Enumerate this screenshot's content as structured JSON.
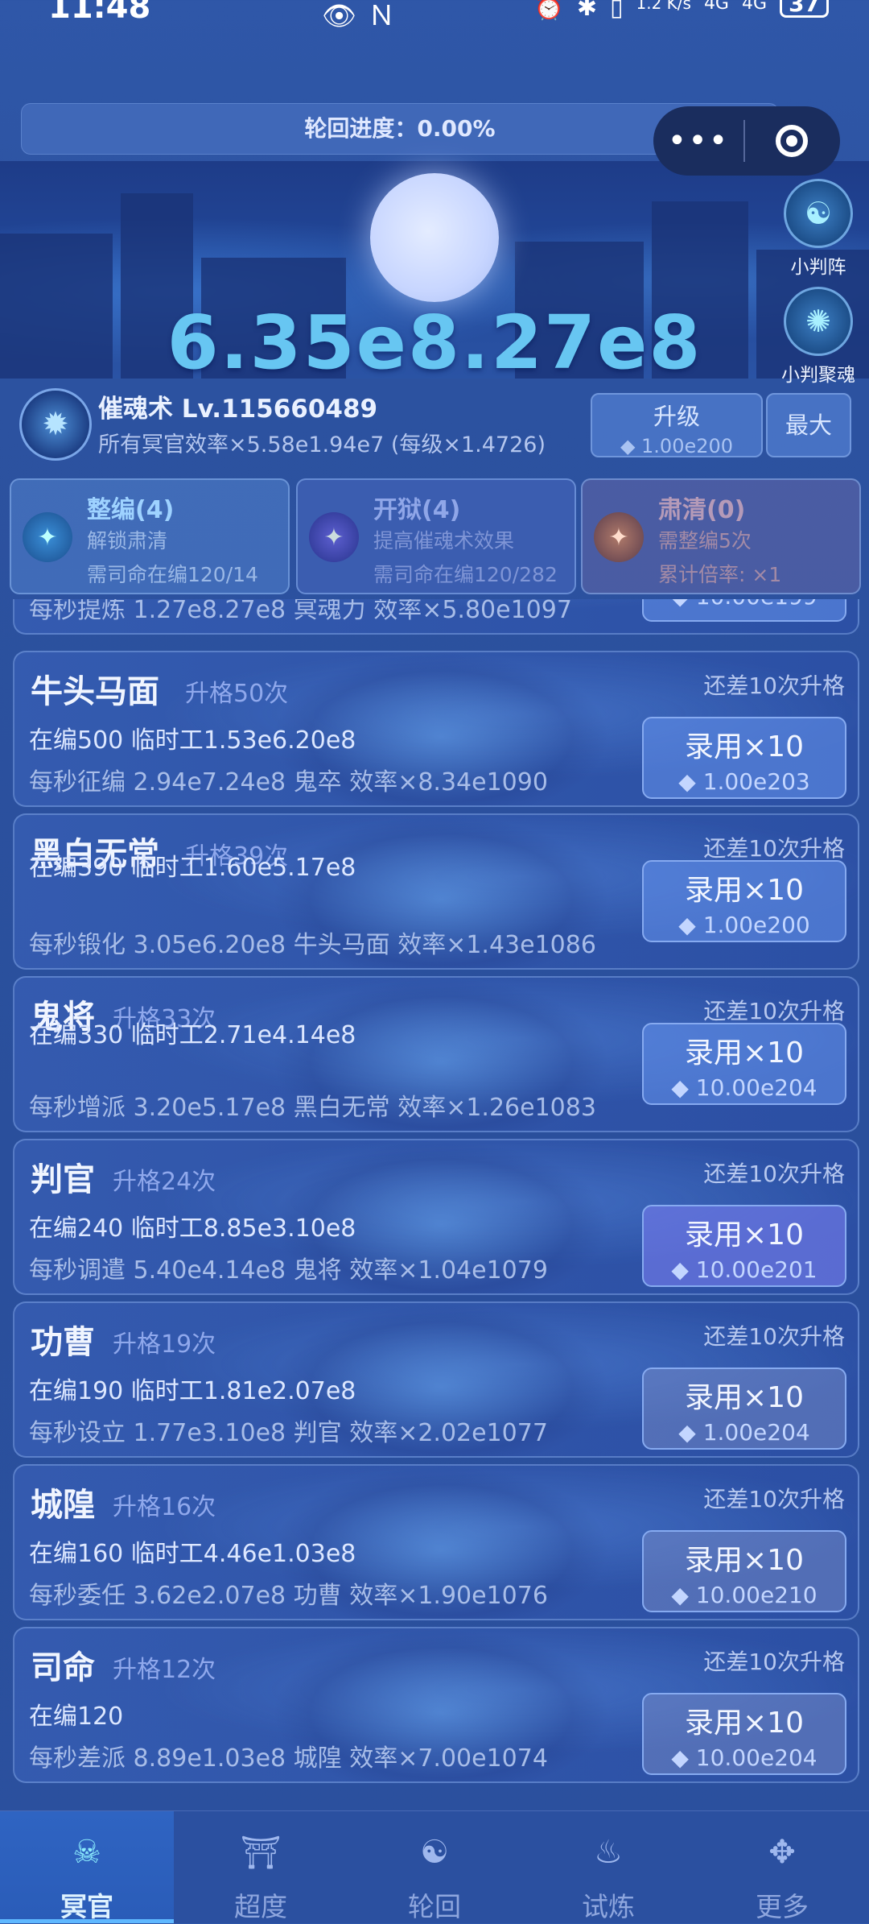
{
  "status_bar": {
    "time": "11:48",
    "icons": [
      "eye-icon",
      "nfc-icon"
    ],
    "right_icons": [
      "alarm-icon",
      "bluetooth-icon",
      "vibrate-icon"
    ],
    "net_speed": "1.2 K/s",
    "signal1": "4G",
    "signal2": "4G",
    "battery": "37"
  },
  "progress": {
    "label": "轮回进度：0.00%",
    "fraction": 0.0
  },
  "hero": {
    "big_number": "6.35e8.27e8"
  },
  "side_buttons": [
    {
      "label": "小判阵",
      "icon": "formation-icon"
    },
    {
      "label": "小判聚魂",
      "icon": "soul-gather-icon"
    }
  ],
  "skill": {
    "title": "催魂术 Lv.115660489",
    "desc": "所有冥官效率×5.58e1.94e7 (每级×1.4726)",
    "upgrade_label": "升级",
    "upgrade_cost": "◆ 1.00e200",
    "max_label": "最大"
  },
  "top_cards": [
    {
      "title": "整编(4)",
      "line1": "解锁肃清",
      "line2": "需司命在编120/14"
    },
    {
      "title": "开狱(4)",
      "line1": "提高催魂术效果",
      "line2": "需司命在编120/282"
    },
    {
      "title": "肃清(0)",
      "line1": "需整编5次",
      "line2": "累计倍率: ×1"
    }
  ],
  "partial_card": {
    "line3": "每秒提炼 1.27e8.27e8 冥魂力  效率×5.80e1097",
    "cost": "◆ 10.00e199"
  },
  "officers": [
    {
      "name": "牛头马面",
      "promo": "升格50次",
      "hint": "还差10次升格",
      "count": "在编500  临时工1.53e6.20e8",
      "rate": "每秒征编 2.94e7.24e8 鬼卒  效率×8.34e1090",
      "hire": "录用×10",
      "cost": "◆ 1.00e203"
    },
    {
      "name": "黑白无常",
      "promo": "升格39次",
      "hint": "还差10次升格",
      "count": "在编390  临时工1.60e5.17e8",
      "rate": "每秒锻化 3.05e6.20e8 牛头马面  效率×1.43e1086",
      "hire": "录用×10",
      "cost": "◆ 1.00e200"
    },
    {
      "name": "鬼将",
      "promo": "升格33次",
      "hint": "还差10次升格",
      "count": "在编330  临时工2.71e4.14e8",
      "rate": "每秒增派 3.20e5.17e8 黑白无常  效率×1.26e1083",
      "hire": "录用×10",
      "cost": "◆ 10.00e204"
    },
    {
      "name": "判官",
      "promo": "升格24次",
      "hint": "还差10次升格",
      "count": "在编240  临时工8.85e3.10e8",
      "rate": "每秒调遣 5.40e4.14e8 鬼将  效率×1.04e1079",
      "hire": "录用×10",
      "cost": "◆ 10.00e201"
    },
    {
      "name": "功曹",
      "promo": "升格19次",
      "hint": "还差10次升格",
      "count": "在编190  临时工1.81e2.07e8",
      "rate": "每秒设立 1.77e3.10e8 判官  效率×2.02e1077",
      "hire": "录用×10",
      "cost": "◆ 1.00e204"
    },
    {
      "name": "城隍",
      "promo": "升格16次",
      "hint": "还差10次升格",
      "count": "在编160  临时工4.46e1.03e8",
      "rate": "每秒委任 3.62e2.07e8 功曹  效率×1.90e1076",
      "hire": "录用×10",
      "cost": "◆ 10.00e210"
    },
    {
      "name": "司命",
      "promo": "升格12次",
      "hint": "还差10次升格",
      "count": "在编120",
      "rate": "每秒差派 8.89e1.03e8 城隍  效率×7.00e1074",
      "hire": "录用×10",
      "cost": "◆ 10.00e204"
    }
  ],
  "nav": [
    {
      "label": "冥官",
      "icon": "ghost-official-icon",
      "active": true
    },
    {
      "label": "超度",
      "icon": "salvation-icon",
      "active": false
    },
    {
      "label": "轮回",
      "icon": "reincarnation-icon",
      "active": false
    },
    {
      "label": "试炼",
      "icon": "trial-icon",
      "active": false
    },
    {
      "label": "更多",
      "icon": "more-icon",
      "active": false
    }
  ],
  "colors": {
    "accent": "#67c6f2",
    "background": "#2c52a0",
    "card_border": "#8cafeb"
  }
}
